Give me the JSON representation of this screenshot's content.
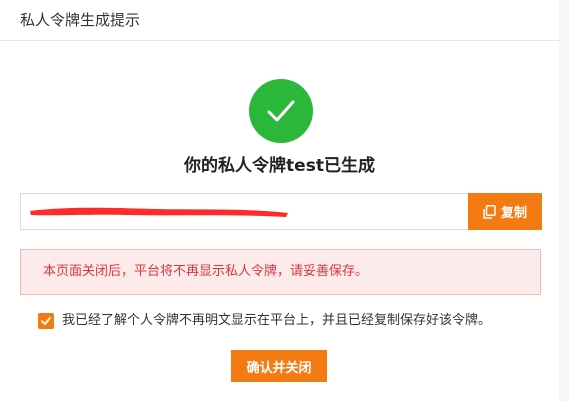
{
  "dialog": {
    "title": "私人令牌生成提示",
    "headline": "你的私人令牌test已生成",
    "token": {
      "value": "",
      "redacted": true
    },
    "copy_button": {
      "label": "复制",
      "icon": "copy-icon"
    },
    "warning": "本页面关闭后，平台将不再显示私人令牌，请妥善保存。",
    "agreement": {
      "checked": true,
      "label": "我已经了解个人令牌不再明文显示在平台上，并且已经复制保存好该令牌。"
    },
    "confirm_button": {
      "label": "确认并关闭"
    }
  },
  "colors": {
    "accent": "#f47a12",
    "success": "#2bb83a",
    "alert_text": "#d9363e",
    "alert_bg": "#fdeaea",
    "redaction": "#ff2b2b"
  }
}
